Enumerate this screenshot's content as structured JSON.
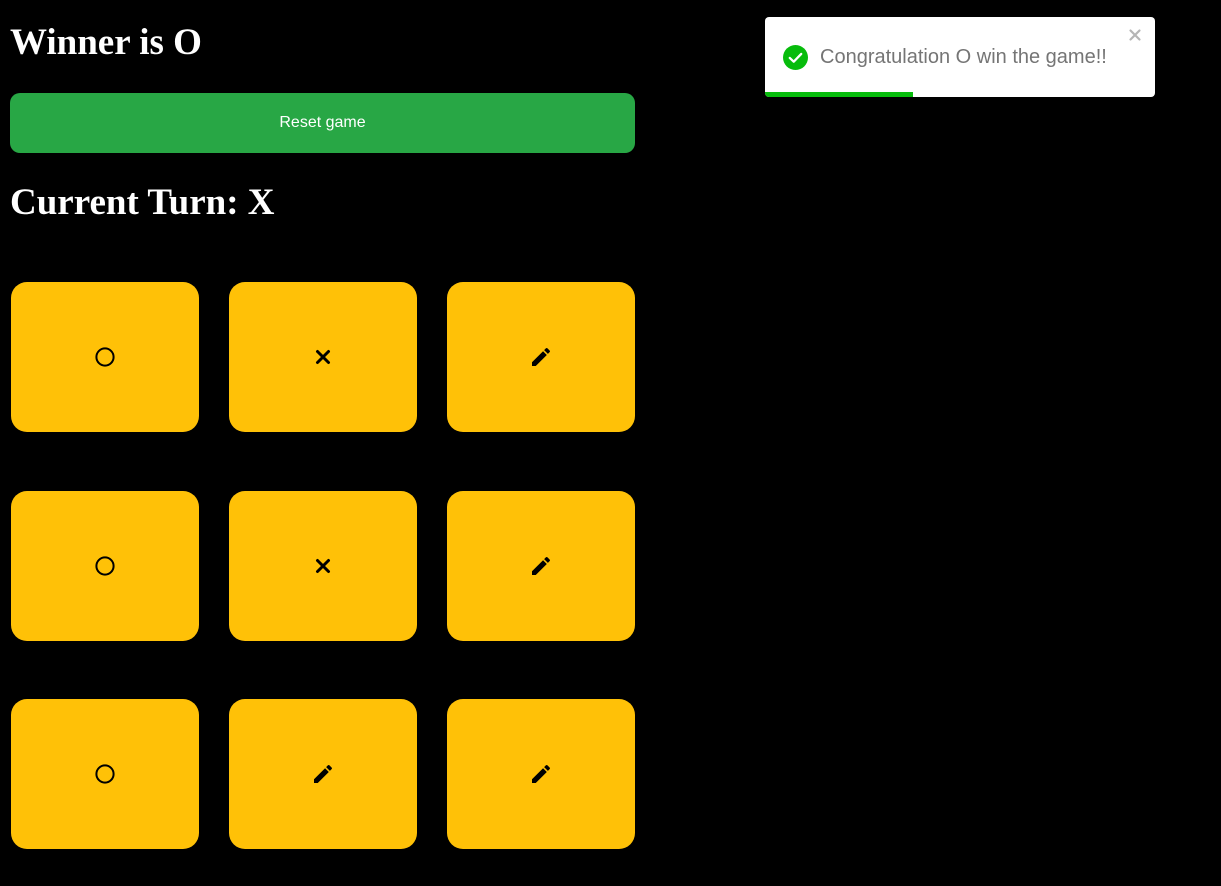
{
  "status": {
    "winner_text": "Winner is O",
    "current_turn_text": "Current Turn: X"
  },
  "controls": {
    "reset_label": "Reset game"
  },
  "board": {
    "cells": [
      {
        "row": 1,
        "col": 1,
        "state": "O",
        "icon": "circle-icon"
      },
      {
        "row": 1,
        "col": 2,
        "state": "X",
        "icon": "x-mark-icon"
      },
      {
        "row": 1,
        "col": 3,
        "state": "empty",
        "icon": "pencil-icon"
      },
      {
        "row": 2,
        "col": 1,
        "state": "O",
        "icon": "circle-icon"
      },
      {
        "row": 2,
        "col": 2,
        "state": "X",
        "icon": "x-mark-icon"
      },
      {
        "row": 2,
        "col": 3,
        "state": "empty",
        "icon": "pencil-icon"
      },
      {
        "row": 3,
        "col": 1,
        "state": "O",
        "icon": "circle-icon"
      },
      {
        "row": 3,
        "col": 2,
        "state": "empty",
        "icon": "pencil-icon"
      },
      {
        "row": 3,
        "col": 3,
        "state": "empty",
        "icon": "pencil-icon"
      }
    ]
  },
  "toast": {
    "message": "Congratulation O win the game!!",
    "icon": "check-circle-icon",
    "close_icon": "close-icon",
    "progress": 0.38
  },
  "colors": {
    "background": "#000000",
    "cell": "#ffc107",
    "reset_button": "#28a745",
    "toast_success": "#07bc0c",
    "toast_close": "#b5b5b5",
    "mark": "#000000"
  }
}
